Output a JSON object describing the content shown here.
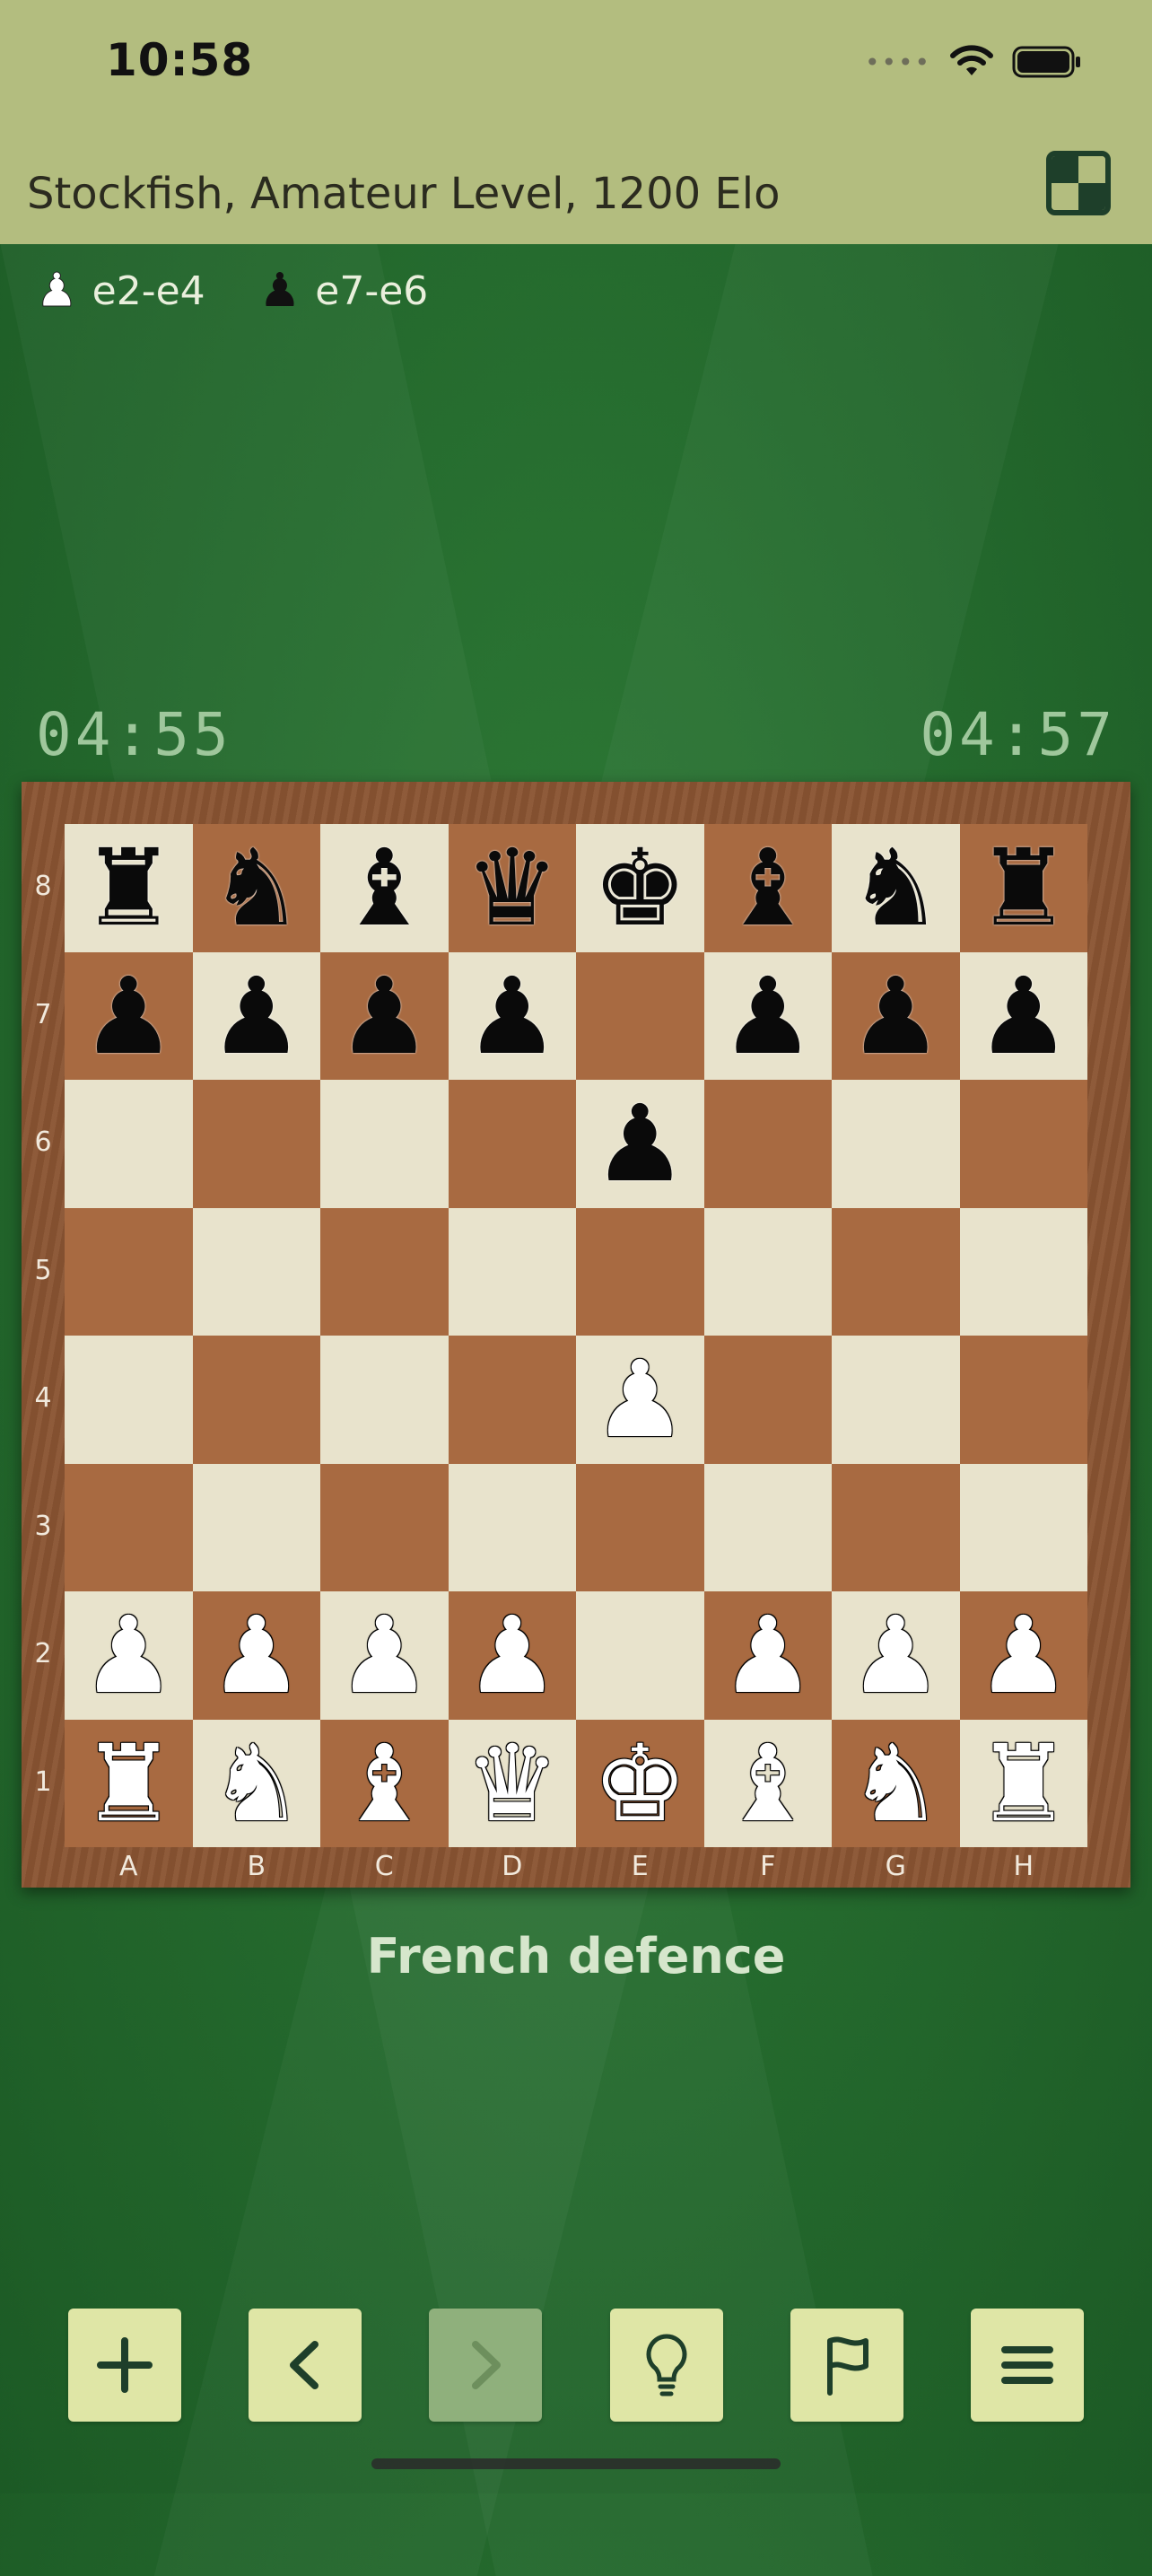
{
  "status_bar": {
    "time": "10:58"
  },
  "header": {
    "title": "Stockfish, Amateur Level, 1200 Elo",
    "board_icon": "board-toggle-icon"
  },
  "moves": [
    {
      "piece": "♟",
      "color": "white",
      "text": "e2-e4"
    },
    {
      "piece": "♟",
      "color": "black",
      "text": "e7-e6"
    }
  ],
  "clocks": {
    "left": "04:55",
    "right": "04:57"
  },
  "board": {
    "ranks": [
      "8",
      "7",
      "6",
      "5",
      "4",
      "3",
      "2",
      "1"
    ],
    "files": [
      "A",
      "B",
      "C",
      "D",
      "E",
      "F",
      "G",
      "H"
    ],
    "position": [
      [
        "br",
        "bn",
        "bb",
        "bq",
        "bk",
        "bb",
        "bn",
        "br"
      ],
      [
        "bp",
        "bp",
        "bp",
        "bp",
        "",
        "bp",
        "bp",
        "bp"
      ],
      [
        "",
        "",
        "",
        "",
        "bp",
        "",
        "",
        ""
      ],
      [
        "",
        "",
        "",
        "",
        "",
        "",
        "",
        ""
      ],
      [
        "",
        "",
        "",
        "",
        "wp",
        "",
        "",
        ""
      ],
      [
        "",
        "",
        "",
        "",
        "",
        "",
        "",
        ""
      ],
      [
        "wp",
        "wp",
        "wp",
        "wp",
        "",
        "wp",
        "wp",
        "wp"
      ],
      [
        "wr",
        "wn",
        "wb",
        "wq",
        "wk",
        "wb",
        "wn",
        "wr"
      ]
    ]
  },
  "opening_name": "French defence",
  "toolbar": [
    {
      "name": "new-game-button",
      "icon": "plus-icon",
      "enabled": true
    },
    {
      "name": "previous-move-button",
      "icon": "chevron-left-icon",
      "enabled": true
    },
    {
      "name": "next-move-button",
      "icon": "chevron-right-icon",
      "enabled": false
    },
    {
      "name": "hint-button",
      "icon": "lightbulb-icon",
      "enabled": true
    },
    {
      "name": "resign-button",
      "icon": "flag-icon",
      "enabled": true
    },
    {
      "name": "menu-button",
      "icon": "hamburger-menu-icon",
      "enabled": true
    }
  ],
  "colors": {
    "light_square": "#e8e3cc",
    "dark_square": "#a86a41",
    "header": "#b3bd7f",
    "background": "#256b2e"
  }
}
